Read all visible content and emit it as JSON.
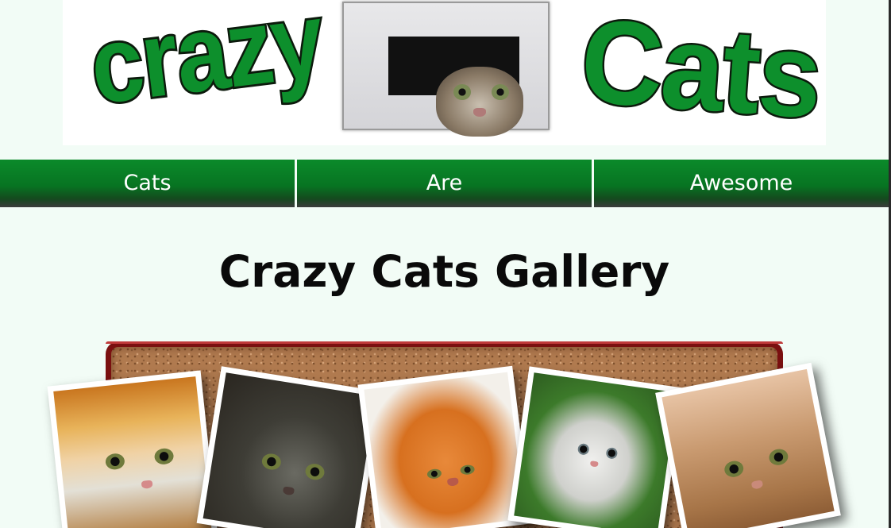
{
  "header": {
    "logo_word_1": "crazy",
    "logo_word_2": "Cats",
    "logo_photo_icon": "cat-peeking-through-hole"
  },
  "nav": {
    "items": [
      {
        "label": "Cats"
      },
      {
        "label": "Are"
      },
      {
        "label": "Awesome"
      }
    ]
  },
  "main": {
    "title": "Crazy Cats Gallery"
  },
  "gallery": {
    "photos": [
      {
        "icon": "cat-under-shelf-photo"
      },
      {
        "icon": "grumpy-tabby-cat-photo"
      },
      {
        "icon": "orange-persian-cat-photo"
      },
      {
        "icon": "white-kitten-in-flowers-photo"
      },
      {
        "icon": "tabby-cat-on-table-photo"
      }
    ]
  },
  "colors": {
    "page_background": "#f2fcf6",
    "nav_green": "#077422",
    "logo_green": "#0d8f2c",
    "cork_border": "#7a1010",
    "cork": "#b07a4f"
  }
}
